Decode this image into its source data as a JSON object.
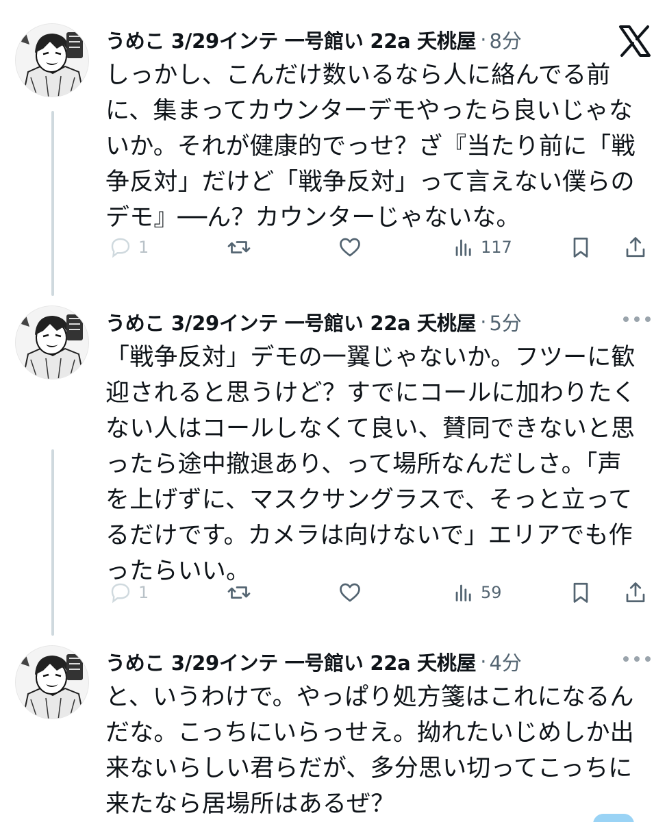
{
  "window": {
    "close_icon": "x-logo-icon"
  },
  "tweets": [
    {
      "author": "うめこ 3/29インテ 一号館い 22a 夭桃屋",
      "separator": "·",
      "time": "8分",
      "text": "しっかし、こんだけ数いるなら人に絡んでる前\nに、集まってカウンターデモやったら良いじゃな\nいか。それが健康的でっせ？ざ『当たり前に「戦\n争反対」だけど「戦争反対」って言えない僕らの\nデモ』──ん？カウンターじゃないな。",
      "replies": "1",
      "views": "117"
    },
    {
      "author": "うめこ 3/29インテ 一号館い 22a 夭桃屋",
      "separator": "·",
      "time": "5分",
      "text": "「戦争反対」デモの一翼じゃないか。フツーに歓\n迎されると思うけど？すでにコールに加わりたく\nない人はコールしなくて良い、賛同できないと思\nったら途中撤退あり、って場所なんだしさ。「声\nを上げずに、マスクサングラスで、そっと立って\nるだけです。カメラは向けないで」エリアでも作\nったらいい。",
      "replies": "1",
      "views": "59"
    },
    {
      "author": "うめこ 3/29インテ 一号館い 22a 夭桃屋",
      "separator": "·",
      "time": "4分",
      "text": "と、いうわけで。やっぱり処方箋はこれになるん\nだな。こっちにいらっせえ。拗れたいじめしか出\n来ないらしい君らだが、多分思い切ってこっちに\n来たなら居場所はあるぜ？"
    }
  ],
  "icons": {
    "reply": "reply-icon",
    "retweet": "retweet-icon",
    "like": "heart-icon",
    "views": "views-icon",
    "bookmark": "bookmark-icon",
    "share": "share-icon",
    "more": "more-icon"
  },
  "colors": {
    "text": "#0f1419",
    "muted": "#536471",
    "thread_line": "#cfd9de"
  }
}
